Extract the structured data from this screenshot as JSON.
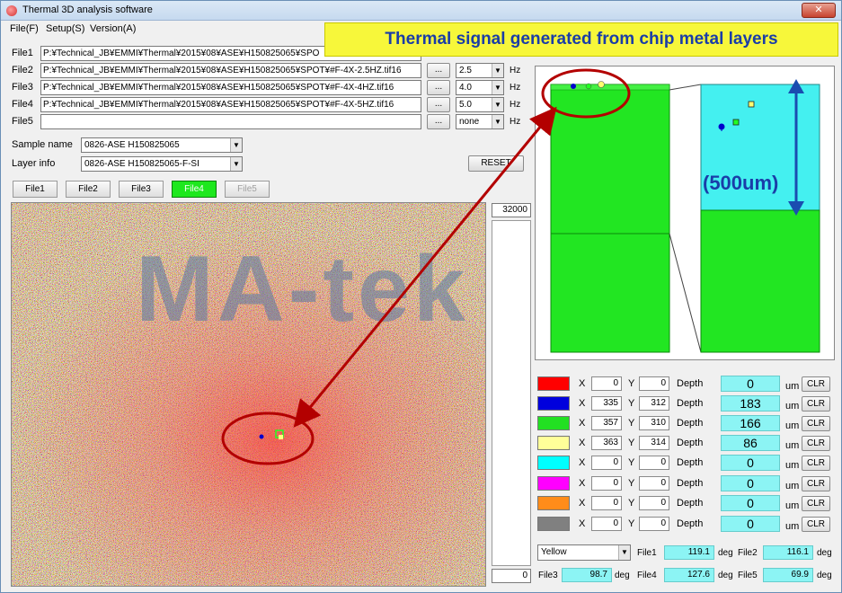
{
  "window": {
    "title": "Thermal 3D analysis software",
    "close_glyph": "✕"
  },
  "menu": [
    "File(F)",
    "Setup(S)",
    "Version(A)"
  ],
  "files": [
    {
      "label": "File1",
      "path": "P:¥Technical_JB¥EMMI¥Thermal¥2015¥08¥ASE¥H150825065¥SPO"
    },
    {
      "label": "File2",
      "path": "P:¥Technical_JB¥EMMI¥Thermal¥2015¥08¥ASE¥H150825065¥SPOT¥#F-4X-2.5HZ.tif16",
      "hz": "2.5"
    },
    {
      "label": "File3",
      "path": "P:¥Technical_JB¥EMMI¥Thermal¥2015¥08¥ASE¥H150825065¥SPOT¥#F-4X-4HZ.tif16",
      "hz": "4.0"
    },
    {
      "label": "File4",
      "path": "P:¥Technical_JB¥EMMI¥Thermal¥2015¥08¥ASE¥H150825065¥SPOT¥#F-4X-5HZ.tif16",
      "hz": "5.0"
    },
    {
      "label": "File5",
      "path": "",
      "hz": "none"
    }
  ],
  "browse_label": "...",
  "hz_unit": "Hz",
  "sample": {
    "label": "Sample name",
    "value": "0826-ASE H150825065"
  },
  "layer": {
    "label": "Layer info",
    "value": "0826-ASE H150825065-F-SI"
  },
  "reset_label": "RESET",
  "tabs": [
    {
      "label": "File1",
      "state": "normal"
    },
    {
      "label": "File2",
      "state": "normal"
    },
    {
      "label": "File3",
      "state": "normal"
    },
    {
      "label": "File4",
      "state": "active"
    },
    {
      "label": "File5",
      "state": "disabled"
    }
  ],
  "scale": {
    "max": "32000",
    "min": "0"
  },
  "banner": "Thermal signal generated from chip metal layers",
  "view3d": {
    "dimension_label": "(500um)"
  },
  "watermark": "MA-tek",
  "markers": [
    {
      "color": "#ff0000",
      "x": "0",
      "y": "0",
      "depth": "0"
    },
    {
      "color": "#0000dd",
      "x": "335",
      "y": "312",
      "depth": "183"
    },
    {
      "color": "#22e022",
      "x": "357",
      "y": "310",
      "depth": "166"
    },
    {
      "color": "#ffff99",
      "x": "363",
      "y": "314",
      "depth": "86"
    },
    {
      "color": "#00ffff",
      "x": "0",
      "y": "0",
      "depth": "0"
    },
    {
      "color": "#ff00ff",
      "x": "0",
      "y": "0",
      "depth": "0"
    },
    {
      "color": "#ff8c1a",
      "x": "0",
      "y": "0",
      "depth": "0"
    },
    {
      "color": "#808080",
      "x": "0",
      "y": "0",
      "depth": "0"
    }
  ],
  "marker_labels": {
    "x": "X",
    "y": "Y",
    "depth": "Depth",
    "unit": "um",
    "clr": "CLR"
  },
  "phase": {
    "selected": "Yellow",
    "unit": "deg",
    "values": [
      {
        "label": "File1",
        "value": "119.1"
      },
      {
        "label": "File2",
        "value": "116.1"
      },
      {
        "label": "File3",
        "value": "98.7"
      },
      {
        "label": "File4",
        "value": "127.6"
      },
      {
        "label": "File5",
        "value": "69.9"
      }
    ]
  }
}
